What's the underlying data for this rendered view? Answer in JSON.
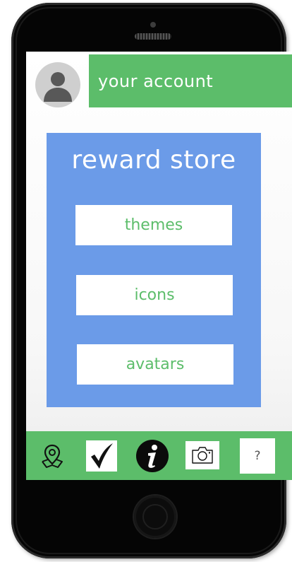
{
  "header": {
    "account_label": "your account"
  },
  "store": {
    "title": "reward store",
    "buttons": [
      {
        "label": "themes"
      },
      {
        "label": "icons"
      },
      {
        "label": "avatars"
      }
    ]
  },
  "bottom_nav": {
    "items": [
      {
        "icon": "map-location-icon"
      },
      {
        "icon": "checkmark-icon"
      },
      {
        "icon": "info-icon"
      },
      {
        "icon": "camera-icon"
      },
      {
        "icon": "help-icon",
        "label": "?"
      }
    ]
  },
  "colors": {
    "green": "#5cbd6a",
    "blue": "#6b9be8",
    "phone_body": "#050505",
    "white": "#ffffff"
  }
}
